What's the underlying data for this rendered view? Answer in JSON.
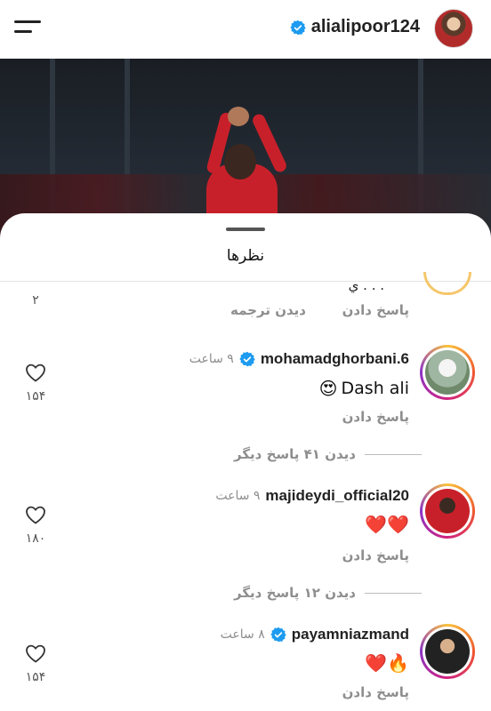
{
  "header": {
    "username": "alialipoor124"
  },
  "sheet": {
    "title": "نظرها"
  },
  "first_comment": {
    "name_fragment": "ي . . .",
    "reply_label": "پاسخ دادن",
    "translate_label": "دیدن ترجمه",
    "like_count": "۲"
  },
  "comments": [
    {
      "username": "mohamadghorbani.6",
      "verified": true,
      "time": "۹ ساعت",
      "text": "Dash ali",
      "emoji": "😍",
      "reply_label": "پاسخ دادن",
      "like_count": "۱۵۴",
      "more_replies": "دیدن ۴۱ پاسخ دیگر"
    },
    {
      "username": "majideydi_official20",
      "verified": false,
      "time": "۹ ساعت",
      "text": "",
      "emoji": "❤️❤️",
      "reply_label": "پاسخ دادن",
      "like_count": "۱۸۰",
      "more_replies": "دیدن ۱۲ پاسخ دیگر"
    },
    {
      "username": "payamniazmand",
      "verified": true,
      "time": "۸ ساعت",
      "text": "",
      "emoji": "❤️🔥",
      "reply_label": "پاسخ دادن",
      "like_count": "۱۵۴"
    }
  ],
  "colors": {
    "verified": "#1d9bf0",
    "muted": "#8e8e8e"
  },
  "icons": [
    "menu-icon",
    "verified-icon",
    "heart-icon"
  ]
}
